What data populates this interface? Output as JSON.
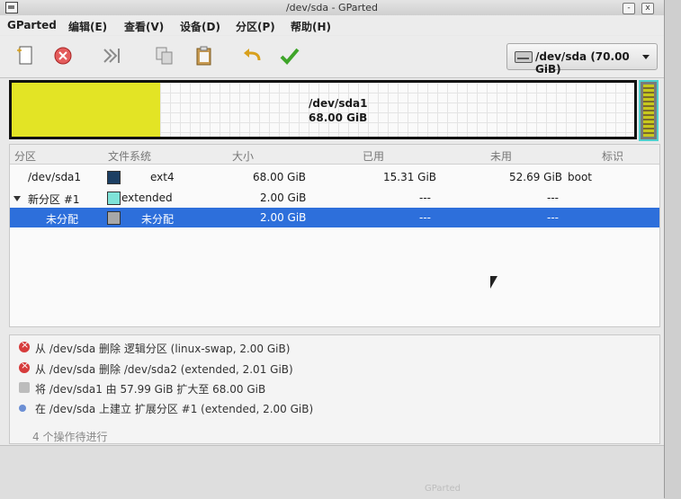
{
  "window": {
    "title": "/dev/sda - GParted",
    "minimize": "-",
    "close": "x"
  },
  "menu": [
    "GParted",
    "编辑(E)",
    "查看(V)",
    "设备(D)",
    "分区(P)",
    "帮助(H)"
  ],
  "toolbar": {
    "icons": [
      "new-icon",
      "delete-icon",
      "resize-move-icon",
      "copy-icon",
      "paste-icon",
      "undo-icon",
      "apply-icon"
    ],
    "device": "/dev/sda (70.00 GiB)"
  },
  "diskmap": {
    "name": "/dev/sda1",
    "size": "68.00 GiB"
  },
  "table": {
    "headers": [
      "分区",
      "文件系统",
      "大小",
      "已用",
      "未用",
      "标识"
    ],
    "rows": [
      {
        "partition": "/dev/sda1",
        "filesystem": "ext4",
        "size": "68.00 GiB",
        "used": "15.31 GiB",
        "unused": "52.69 GiB",
        "flags": "boot",
        "color": "#1c3f63"
      },
      {
        "partition": "新分区 #1",
        "filesystem": "extended",
        "size": "2.00 GiB",
        "used": "---",
        "unused": "---",
        "flags": "",
        "color": "#7fe3d8"
      },
      {
        "partition": "未分配",
        "filesystem": "未分配",
        "size": "2.00 GiB",
        "used": "---",
        "unused": "---",
        "flags": "",
        "color": "#a8a8a8"
      }
    ]
  },
  "pending_ops": [
    {
      "type": "delete",
      "text": "从 /dev/sda 删除 逻辑分区 (linux-swap, 2.00 GiB)"
    },
    {
      "type": "delete",
      "text": "从 /dev/sda 删除 /dev/sda2 (extended, 2.01 GiB)"
    },
    {
      "type": "resize",
      "text": "将 /dev/sda1 由 57.99 GiB 扩大至 68.00 GiB"
    },
    {
      "type": "new",
      "text": "在 /dev/sda 上建立 扩展分区 #1 (extended, 2.00 GiB)"
    }
  ],
  "pending_footer": "4 个操作待进行",
  "status_ghost": "GParted"
}
